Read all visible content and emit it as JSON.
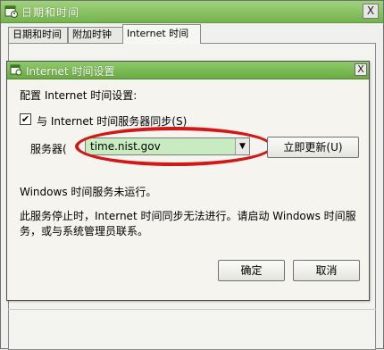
{
  "outer_window": {
    "title": "日期和时间",
    "close_label": "X",
    "tabs": [
      {
        "label": "日期和时间"
      },
      {
        "label": "附加时钟"
      },
      {
        "label": "Internet 时间"
      }
    ]
  },
  "dialog": {
    "title": "Internet 时间设置",
    "close_label": "X",
    "intro": "配置 Internet 时间设置:",
    "sync_checkbox": {
      "checked_mark": "✔",
      "label": "与 Internet 时间服务器同步(S)"
    },
    "server_label": "服务器(",
    "server_value": "time.nist.gov",
    "update_button": "立即更新(U)",
    "status": "Windows 时间服务未运行。",
    "description": "此服务停止时，Internet 时间同步无法进行。请启动 Windows 时间服务，或与系统管理员联系。",
    "ok_button": "确定",
    "cancel_button": "取消"
  },
  "colors": {
    "titlebar_green": "#76b34e",
    "combo_highlight": "#c9ebc0",
    "annotation_red": "#d41616"
  }
}
